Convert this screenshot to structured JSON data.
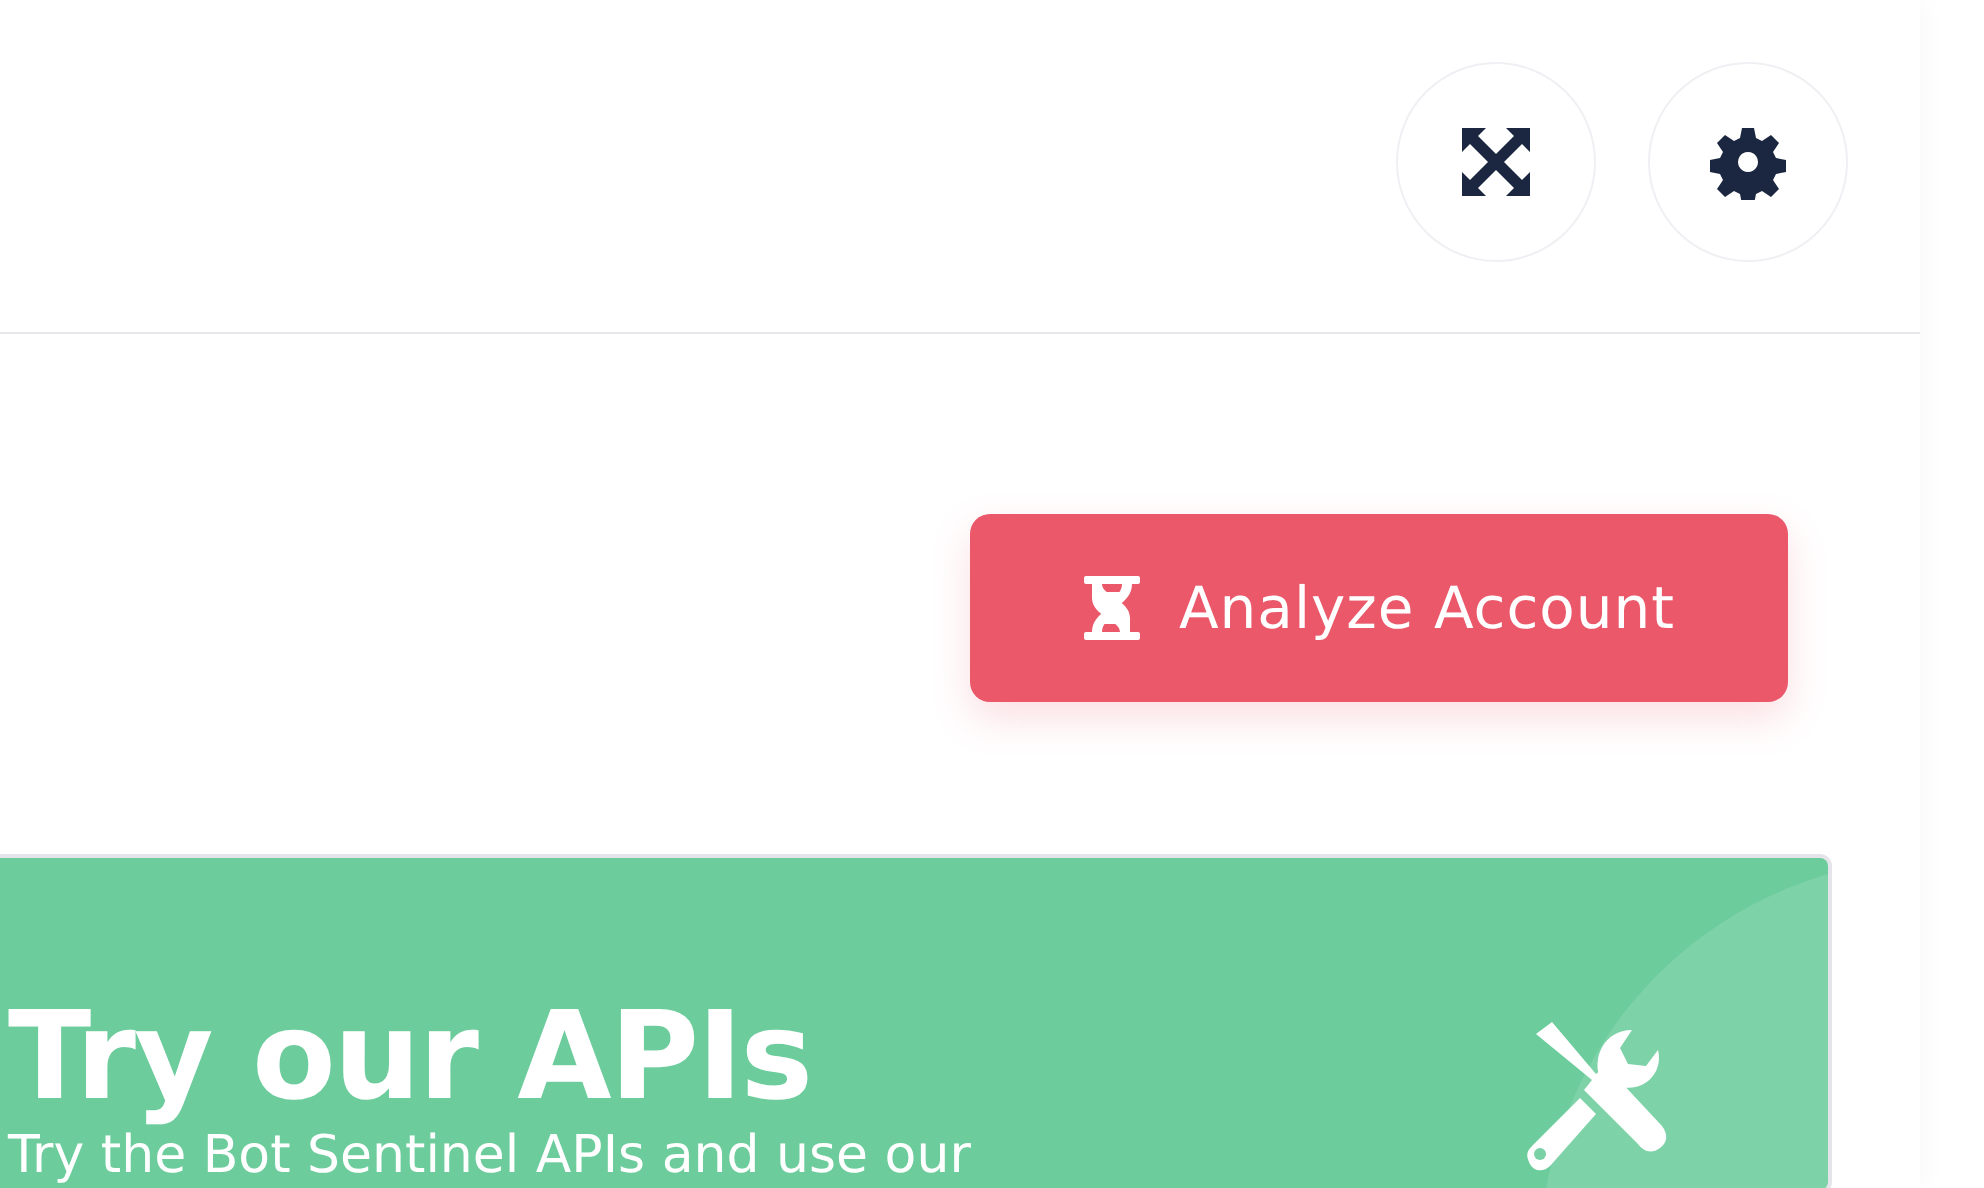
{
  "header": {
    "buttons": [
      {
        "kind": "fullscreen"
      },
      {
        "kind": "settings"
      }
    ]
  },
  "action_button": {
    "label": "Analyze Account"
  },
  "promo_card": {
    "title": "Try our APIs",
    "text": "Try the Bot Sentinel APIs and use our"
  }
}
